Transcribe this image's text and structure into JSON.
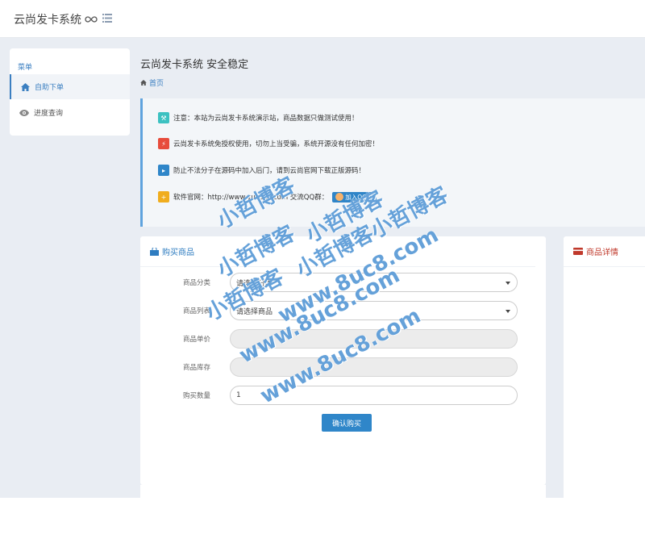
{
  "header": {
    "brand": "云尚发卡系统"
  },
  "sidebar": {
    "title": "菜单",
    "items": [
      {
        "label": "自助下单",
        "icon": "home-icon"
      },
      {
        "label": "进度查询",
        "icon": "eye-icon"
      }
    ]
  },
  "main": {
    "title": "云尚发卡系统 安全稳定",
    "breadcrumb": "首页"
  },
  "notices": [
    {
      "icon": "bell-icon",
      "color": "#3cc1c1",
      "text": "注意：本站为云尚发卡系统演示站，商品数据只做测试使用！"
    },
    {
      "icon": "bolt-icon",
      "color": "#e74c3c",
      "text": "云尚发卡系统免授权使用，切勿上当受骗，系统开源没有任何加密！"
    },
    {
      "icon": "megaphone-icon",
      "color": "#2f86c9",
      "text": "防止不法分子在源码中加入后门，请到云尚官网下载正版源码！"
    },
    {
      "icon": "plus-icon",
      "color": "#f0ad1e",
      "text": "软件官网：http://www.yunscx.com   交流QQ群："
    }
  ],
  "qq_button": "加入QQ群",
  "buy_panel": {
    "title": "购买商品",
    "fields": [
      {
        "label": "商品分类",
        "value": "请选择分类",
        "type": "select"
      },
      {
        "label": "商品列表",
        "value": "请选择商品",
        "type": "select"
      },
      {
        "label": "商品单价",
        "value": "",
        "type": "readonly"
      },
      {
        "label": "商品库存",
        "value": "",
        "type": "readonly"
      },
      {
        "label": "购买数量",
        "value": "1",
        "type": "input"
      }
    ],
    "submit": "确认购买"
  },
  "detail_panel": {
    "title": "商品详情"
  },
  "watermark": {
    "line1": "小哲博客",
    "line2": "www.8uc8.com"
  }
}
